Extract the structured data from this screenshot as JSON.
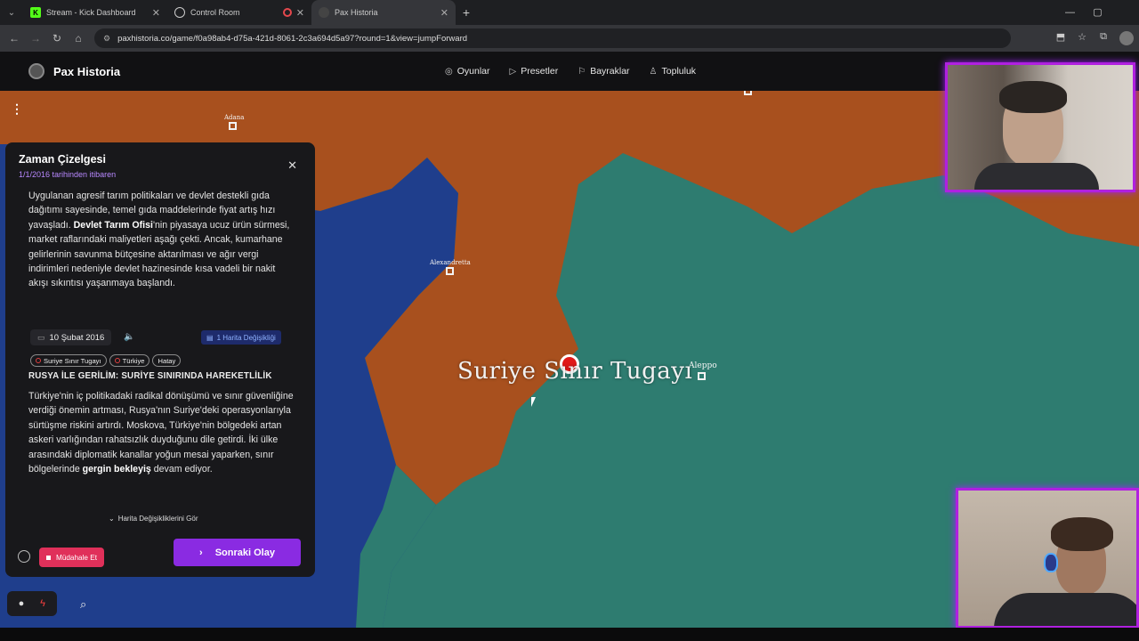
{
  "browser": {
    "tabs": [
      {
        "title": "Stream - Kick Dashboard",
        "icon": "kick-icon",
        "active": false
      },
      {
        "title": "Control Room",
        "icon": "globe-icon",
        "active": false
      },
      {
        "title": "Pax Historia",
        "icon": "pax-icon",
        "active": true
      }
    ],
    "url": "paxhistoria.co/game/f0a98ab4-d75a-421d-8061-2c3a694d5a97?round=1&view=jumpForward"
  },
  "app": {
    "name": "Pax Historia",
    "nav": [
      {
        "label": "Oyunlar",
        "icon": "gamepad-icon"
      },
      {
        "label": "Presetler",
        "icon": "play-icon"
      },
      {
        "label": "Bayraklar",
        "icon": "flag-icon"
      },
      {
        "label": "Topluluk",
        "icon": "users-icon"
      }
    ]
  },
  "map": {
    "cities": [
      {
        "name": "Adana"
      },
      {
        "name": "Alexandretta"
      },
      {
        "name": "Aleppo"
      }
    ],
    "event_label": "Suriye Sınır Tugayı",
    "colors": {
      "turkey": "#a8501e",
      "syria": "#2e7c70",
      "sea": "#1f3e8c"
    }
  },
  "timeline": {
    "title": "Zaman Çizelgesi",
    "subtitle": "1/1/2016 tarihinden itibaren",
    "prev_event": {
      "text_a": "Uygulanan agresif tarım politikaları ve devlet destekli gıda dağıtımı sayesinde, temel gıda maddelerinde fiyat artış hızı yavaşladı. ",
      "bold": "Devlet Tarım Ofisi",
      "text_b": "'nin piyasaya ucuz ürün sürmesi, market raflarındaki maliyetleri aşağı çekti. Ancak, kumarhane gelirlerinin savunma bütçesine aktarılması ve ağır vergi indirimleri nedeniyle devlet hazinesinde kısa vadeli bir nakit akışı sıkıntısı yaşanmaya başlandı."
    },
    "event": {
      "date": "10 Şubat 2016",
      "map_changes_badge": "1 Harita Değişikliği",
      "tags": [
        "Suriye Sınır Tugayı",
        "Türkiye",
        "Hatay"
      ],
      "title": "RUSYA İLE GERİLİM: SURİYE SINIRINDA HAREKETLİLİK",
      "text_a": "Türkiye'nin iç politikadaki radikal dönüşümü ve sınır güvenliğine verdiği önemin artması, Rusya'nın Suriye'deki operasyonlarıyla sürtüşme riskini artırdı. Moskova, Türkiye'nin bölgedeki artan askeri varlığından rahatsızlık duyduğunu dile getirdi. İki ülke arasındaki diplomatik kanallar yoğun mesai yaparken, sınır bölgelerinde ",
      "bold": "gergin bekleyiş",
      "text_b": " devam ediyor."
    },
    "map_changes_toggle": "Harita Değişikliklerini Gör",
    "intervene_label": "Müdahale Et",
    "next_label": "Sonraki Olay"
  }
}
